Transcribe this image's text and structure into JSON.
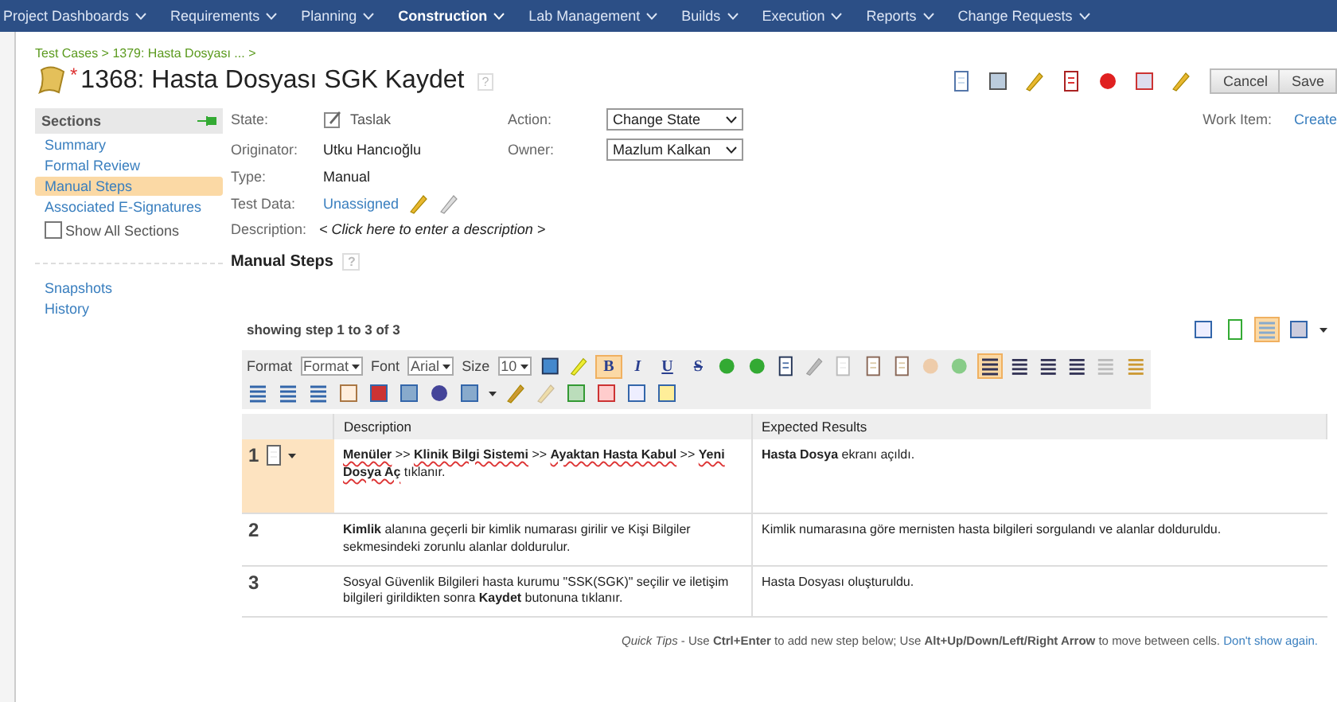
{
  "nav": [
    {
      "label": "Project Dashboards",
      "selected": false
    },
    {
      "label": "Requirements",
      "selected": false
    },
    {
      "label": "Planning",
      "selected": false
    },
    {
      "label": "Construction",
      "selected": true
    },
    {
      "label": "Lab Management",
      "selected": false
    },
    {
      "label": "Builds",
      "selected": false
    },
    {
      "label": "Execution",
      "selected": false
    },
    {
      "label": "Reports",
      "selected": false
    },
    {
      "label": "Change Requests",
      "selected": false
    }
  ],
  "breadcrumb": "Test Cases > 1379: Hasta Dosyası ... >",
  "title": {
    "modified_mark": "*",
    "text": "1368: Hasta Dosyası SGK Kaydet",
    "help": "?"
  },
  "buttons": [
    {
      "label": "Cancel"
    },
    {
      "label": "Save"
    }
  ],
  "sidebar": {
    "title": "Sections",
    "items": [
      {
        "label": "Summary",
        "selected": false
      },
      {
        "label": "Formal Review",
        "selected": false
      },
      {
        "label": "Manual Steps",
        "selected": true
      },
      {
        "label": "Associated E-Signatures",
        "selected": false
      }
    ],
    "show_all": {
      "label": "Show All Sections",
      "checked": false
    },
    "links": [
      "Snapshots",
      "History"
    ]
  },
  "fields": {
    "state_label": "State:",
    "state": "Taslak",
    "originator_label": "Originator:",
    "originator": "Utku Hancıoğlu",
    "type_label": "Type:",
    "type": "Manual",
    "test_data_label": "Test Data:",
    "test_data": "Unassigned",
    "description_label": "Description:",
    "description_placeholder": "< Click here to enter a description >",
    "action_label": "Action:",
    "action": "Change State",
    "owner_label": "Owner:",
    "owner": "Mazlum Kalkan",
    "work_item_label": "Work Item:",
    "work_item": "Create"
  },
  "manual_steps": {
    "title": "Manual Steps",
    "help": "?",
    "showing": "showing step 1 to 3 of 3",
    "toolbar": {
      "format_label": "Format",
      "format": "Format",
      "font_label": "Font",
      "font": "Arial",
      "size_label": "Size",
      "size": "10",
      "text_buttons": [
        {
          "label": "B",
          "on": true
        },
        {
          "label": "I",
          "on": false
        },
        {
          "label": "U",
          "on": false
        },
        {
          "label": "S",
          "on": false
        }
      ],
      "align_left_on": true,
      "table_view_on": true
    },
    "columns": [
      "Description",
      "Expected Results"
    ],
    "steps": [
      {
        "number": "1",
        "selected": true,
        "spellcheck": true,
        "description": "**Menüler** >> **Klinik Bilgi Sistemi** >> **Ayaktan Hasta Kabul** >> **Yeni Dosya Aç** tıklanır.",
        "expected": "**Hasta Dosya** ekranı açıldı."
      },
      {
        "number": "2",
        "selected": false,
        "spellcheck": false,
        "description": "**Kimlik** alanına geçerli bir kimlik numarası girilir ve Kişi Bilgiler sekmesindeki zorunlu alanlar doldurulur.",
        "expected": "Kimlik numarasına göre mernisten hasta bilgileri sorgulandı ve alanlar dolduruldu."
      },
      {
        "number": "3",
        "selected": false,
        "spellcheck": false,
        "description": "Sosyal Güvenlik Bilgileri hasta kurumu \"SSK(SGK)\" seçilir ve iletişim bilgileri girildikten sonra **Kaydet** butonuna tıklanır.",
        "expected": "Hasta Dosyası oluşturuldu."
      }
    ],
    "tips": "*Quick Tips* - Use **Ctrl+Enter** to add new step below; Use **Alt+Up/Down/Left/Right Arrow** to move between cells.",
    "tips_link": "Don't show again."
  }
}
